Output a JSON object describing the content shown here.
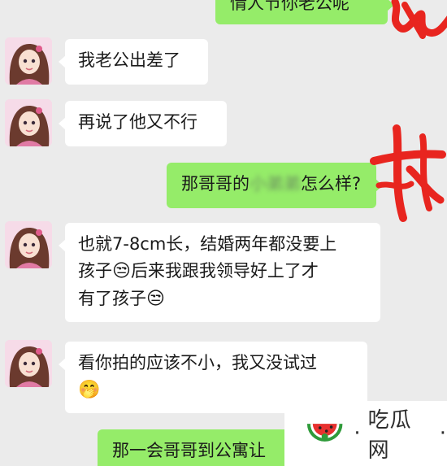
{
  "messages": [
    {
      "side": "out",
      "text": "情人节你老公呢"
    },
    {
      "side": "in",
      "text": "我老公出差了"
    },
    {
      "side": "in",
      "text": "再说了他又不行"
    },
    {
      "side": "out",
      "text_before": "那哥哥的",
      "text_redacted": "小弟弟",
      "text_after": "怎么样?"
    },
    {
      "side": "in",
      "lines": [
        "也就7-8cm长，结婚两年都没要上",
        "孩子",
        "后来我跟我领导好上了才",
        "有了孩子"
      ]
    },
    {
      "side": "in",
      "lines": [
        "看你拍的应该不小，我又没试过"
      ]
    },
    {
      "side": "out",
      "text": "那一会哥哥到公寓让"
    }
  ],
  "emoji": {
    "unamused": "😒",
    "shy": "🤭"
  },
  "watermark": {
    "text": "吃瓜网",
    "separator": "·",
    "logo": "watermelon-logo-icon"
  },
  "colors": {
    "background": "#ebebeb",
    "incoming_bubble": "#ffffff",
    "outgoing_bubble": "#95ec69",
    "annotation": "#e8251f"
  }
}
